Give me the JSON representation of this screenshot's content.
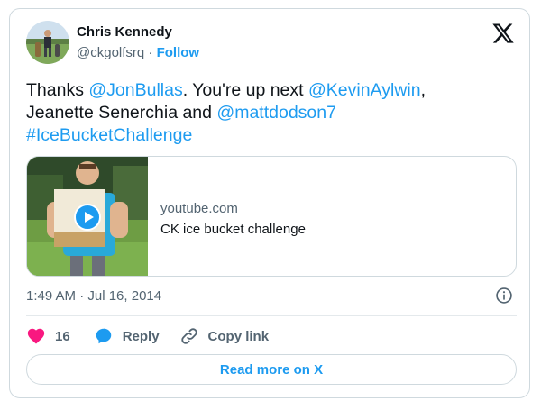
{
  "author": {
    "name": "Chris Kennedy",
    "handle": "@ckgolfsrq",
    "separator": "·",
    "follow_label": "Follow"
  },
  "tweet": {
    "text_parts": {
      "p1": "Thanks ",
      "m1": "@JonBullas",
      "p2": ". You're up next ",
      "m2": "@KevinAylwin",
      "p3": ",",
      "p4": "Jeanette Senerchia and ",
      "m3": "@mattdodson7",
      "h1": "#IceBucketChallenge"
    }
  },
  "link_card": {
    "domain": "youtube.com",
    "title": "CK ice bucket challenge"
  },
  "meta": {
    "timestamp": "1:49 AM · Jul 16, 2014"
  },
  "actions": {
    "likes_count": "16",
    "reply_label": "Reply",
    "copy_link_label": "Copy link"
  },
  "footer": {
    "read_more_label": "Read more on X"
  },
  "icons": {
    "logo": "x-logo-icon",
    "info": "info-icon",
    "heart": "heart-icon",
    "reply": "reply-bubble-icon",
    "link": "link-icon",
    "play": "play-icon"
  },
  "colors": {
    "accent": "#1d9bf0",
    "heart": "#f91880",
    "text": "#0f1419",
    "muted": "#536471",
    "border": "#cfd9de"
  }
}
